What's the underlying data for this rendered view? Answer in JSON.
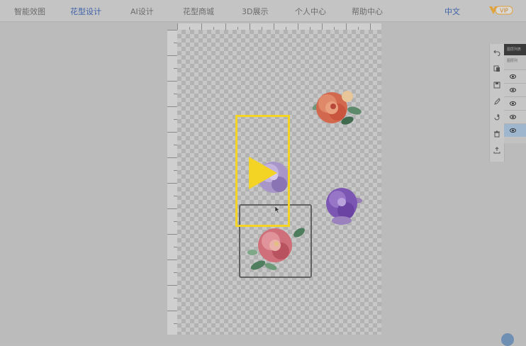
{
  "nav": {
    "items": [
      {
        "label": "智能效图"
      },
      {
        "label": "花型设计"
      },
      {
        "label": "AI设计"
      },
      {
        "label": "花型商城"
      },
      {
        "label": "3D展示"
      },
      {
        "label": "个人中心"
      },
      {
        "label": "帮助中心"
      }
    ],
    "active_index": 1,
    "language": "中文",
    "vip_badge": "VIP"
  },
  "layers": {
    "header": "图层列表",
    "title": "图层列",
    "rows": [
      {
        "visible": true,
        "selected": false
      },
      {
        "visible": true,
        "selected": false
      },
      {
        "visible": true,
        "selected": false
      },
      {
        "visible": true,
        "selected": false
      },
      {
        "visible": true,
        "selected": true
      }
    ]
  },
  "tools": [
    {
      "icon": "undo-icon"
    },
    {
      "icon": "copy-icon"
    },
    {
      "icon": "save-icon"
    },
    {
      "icon": "brush-icon"
    },
    {
      "icon": "redo-icon"
    },
    {
      "icon": "delete-icon"
    },
    {
      "icon": "export-icon"
    }
  ],
  "video_overlay": {
    "icon": "play-icon",
    "color": "#f3d425"
  },
  "colors": {
    "accent": "#3f62a8",
    "selected_layer": "#9fb6cf"
  }
}
